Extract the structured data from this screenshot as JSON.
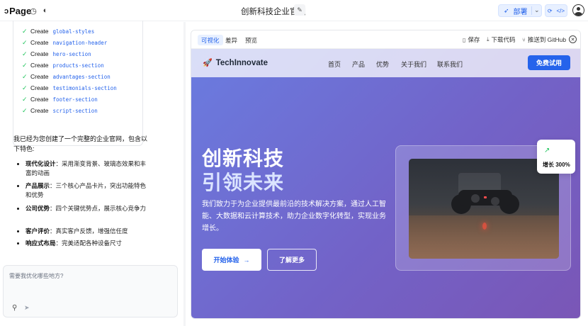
{
  "app": {
    "logo": "Page",
    "project_title": "创新科技企业官网",
    "deploy_label": "部署"
  },
  "steps": [
    {
      "verb": "Create",
      "name": "global-styles"
    },
    {
      "verb": "Create",
      "name": "navigation-header"
    },
    {
      "verb": "Create",
      "name": "hero-section"
    },
    {
      "verb": "Create",
      "name": "products-section"
    },
    {
      "verb": "Create",
      "name": "advantages-section"
    },
    {
      "verb": "Create",
      "name": "testimonials-section"
    },
    {
      "verb": "Create",
      "name": "footer-section"
    },
    {
      "verb": "Create",
      "name": "script-section"
    }
  ],
  "chat": {
    "intro": "我已经为您创建了一个完整的企业官网，包含以下特色:",
    "features": [
      {
        "title": "现代化设计",
        "desc": "：采用渐变背景、玻璃态效果和丰富的动画"
      },
      {
        "title": "产品展示",
        "desc": "：三个核心产品卡片，突出功能特色和优势"
      },
      {
        "title": "公司优势",
        "desc": "：四个关键优势点，展示核心竞争力"
      },
      {
        "title": "客户评价",
        "desc": "：真实客户反馈，增强信任度"
      },
      {
        "title": "响应式布局",
        "desc": "：完美适配各种设备尺寸"
      }
    ],
    "input_placeholder": "需要我优化哪些地方?"
  },
  "preview": {
    "tabs": [
      "可视化",
      "差异",
      "预览"
    ],
    "active_tab": "可视化",
    "actions": {
      "save": "保存",
      "download": "下载代码",
      "push": "推送到 GitHub"
    }
  },
  "site": {
    "brand": "TechInnovate",
    "nav": [
      "首页",
      "产品",
      "优势",
      "关于我们",
      "联系我们"
    ],
    "cta_top": "免费试用",
    "hero_line1": "创新科技",
    "hero_line2": "引领未来",
    "hero_desc": "我们致力于为企业提供最前沿的技术解决方案，通过人工智能、大数据和云计算技术，助力企业数字化转型，实现业务增长。",
    "btn_primary": "开始体验",
    "btn_secondary": "了解更多",
    "growth_badge": "增长 300%"
  },
  "colors": {
    "accent": "#2563eb",
    "success": "#22c55e"
  }
}
